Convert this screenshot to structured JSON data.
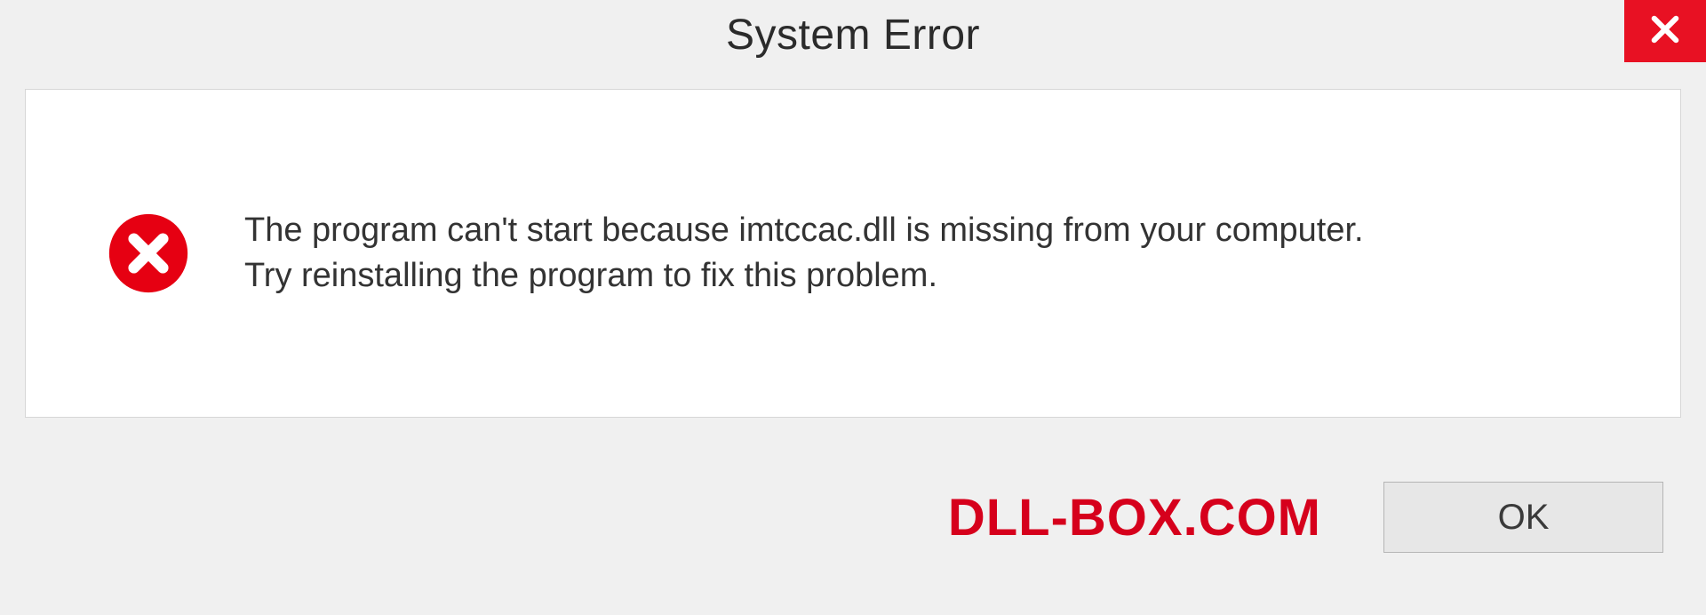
{
  "dialog": {
    "title": "System Error",
    "message": "The program can't start because imtccac.dll is missing from your computer.\nTry reinstalling the program to fix this problem.",
    "ok_label": "OK"
  },
  "watermark": "DLL-BOX.COM",
  "colors": {
    "accent_red": "#e81123",
    "watermark_red": "#d6001c"
  },
  "icons": {
    "close": "close-icon",
    "error": "error-circle-x-icon"
  }
}
